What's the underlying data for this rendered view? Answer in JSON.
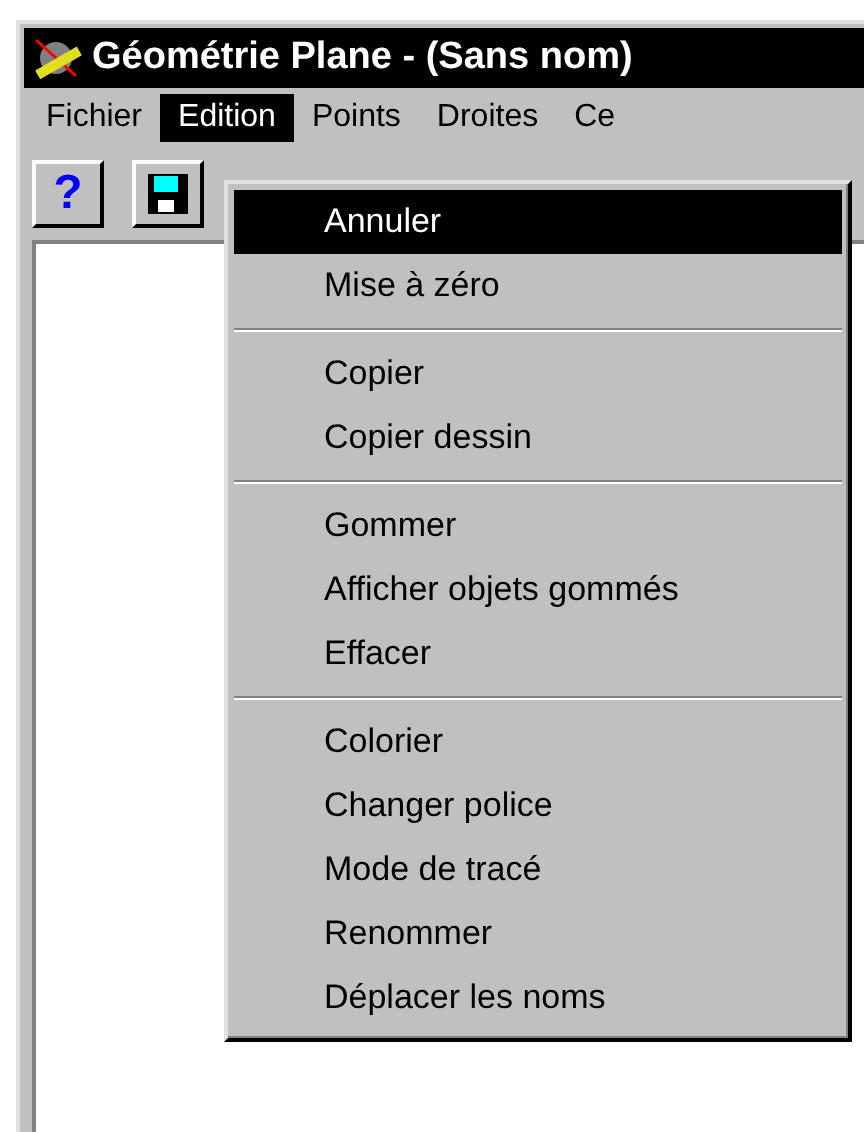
{
  "window": {
    "title": "Géométrie Plane - (Sans nom)"
  },
  "menu_bar": [
    {
      "label": "Fichier",
      "selected": false
    },
    {
      "label": "Edition",
      "selected": true
    },
    {
      "label": "Points",
      "selected": false
    },
    {
      "label": "Droites",
      "selected": false
    },
    {
      "label": "Ce",
      "selected": false
    }
  ],
  "dropdown": {
    "groups": [
      [
        {
          "label": "Annuler",
          "selected": true
        },
        {
          "label": "Mise à zéro",
          "selected": false
        }
      ],
      [
        {
          "label": "Copier",
          "selected": false
        },
        {
          "label": "Copier dessin",
          "selected": false
        }
      ],
      [
        {
          "label": "Gommer",
          "selected": false
        },
        {
          "label": "Afficher objets gommés",
          "selected": false
        },
        {
          "label": "Effacer",
          "selected": false
        }
      ],
      [
        {
          "label": "Colorier",
          "selected": false
        },
        {
          "label": "Changer police",
          "selected": false
        },
        {
          "label": "Mode de tracé",
          "selected": false
        },
        {
          "label": "Renommer",
          "selected": false
        },
        {
          "label": "Déplacer les noms",
          "selected": false
        }
      ]
    ]
  },
  "toolbar": {
    "help_button": "?"
  }
}
